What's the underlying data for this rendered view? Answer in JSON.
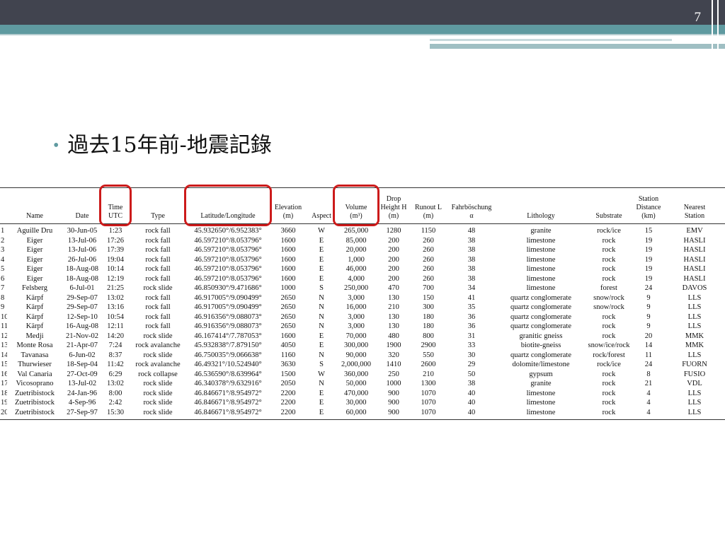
{
  "slide": {
    "page_number": "7",
    "bullet_title": "過去15年前-地震記錄"
  },
  "colors": {
    "top_band": "#41444f",
    "accent_teal": "#5f9aa0",
    "highlight_red": "#cc1b1b"
  },
  "table": {
    "headers": [
      {
        "key": "idx",
        "label": ""
      },
      {
        "key": "name",
        "label": "Name"
      },
      {
        "key": "date",
        "label": "Date"
      },
      {
        "key": "time",
        "label": "Time\nUTC"
      },
      {
        "key": "type",
        "label": "Type"
      },
      {
        "key": "latlon",
        "label": "Latitude/Longitude"
      },
      {
        "key": "elev",
        "label": "Elevation\n(m)"
      },
      {
        "key": "aspect",
        "label": "Aspect"
      },
      {
        "key": "volume",
        "label": "Volume\n(m³)"
      },
      {
        "key": "drop",
        "label": "Drop\nHeight H\n(m)"
      },
      {
        "key": "runout",
        "label": "Runout L\n(m)"
      },
      {
        "key": "fahr",
        "label": "Fahrböschung\nα"
      },
      {
        "key": "litho",
        "label": "Lithology"
      },
      {
        "key": "substrate",
        "label": "Substrate"
      },
      {
        "key": "dist",
        "label": "Station\nDistance\n(km)"
      },
      {
        "key": "station",
        "label": "Nearest\nStation"
      }
    ],
    "highlighted_columns": [
      "time",
      "latlon",
      "volume"
    ],
    "rows": [
      [
        "1",
        "Aguille Dru",
        "30-Jun-05",
        "1:23",
        "rock fall",
        "45.932650°/6.952383°",
        "3660",
        "W",
        "265,000",
        "1280",
        "1150",
        "48",
        "granite",
        "rock/ice",
        "15",
        "EMV"
      ],
      [
        "2",
        "Eiger",
        "13-Jul-06",
        "17:26",
        "rock fall",
        "46.597210°/8.053796°",
        "1600",
        "E",
        "85,000",
        "200",
        "260",
        "38",
        "limestone",
        "rock",
        "19",
        "HASLI"
      ],
      [
        "3",
        "Eiger",
        "13-Jul-06",
        "17:39",
        "rock fall",
        "46.597210°/8.053796°",
        "1600",
        "E",
        "20,000",
        "200",
        "260",
        "38",
        "limestone",
        "rock",
        "19",
        "HASLI"
      ],
      [
        "4",
        "Eiger",
        "26-Jul-06",
        "19:04",
        "rock fall",
        "46.597210°/8.053796°",
        "1600",
        "E",
        "1,000",
        "200",
        "260",
        "38",
        "limestone",
        "rock",
        "19",
        "HASLI"
      ],
      [
        "5",
        "Eiger",
        "18-Aug-08",
        "10:14",
        "rock fall",
        "46.597210°/8.053796°",
        "1600",
        "E",
        "46,000",
        "200",
        "260",
        "38",
        "limestone",
        "rock",
        "19",
        "HASLI"
      ],
      [
        "6",
        "Eiger",
        "18-Aug-08",
        "12:19",
        "rock fall",
        "46.597210°/8.053796°",
        "1600",
        "E",
        "4,000",
        "200",
        "260",
        "38",
        "limestone",
        "rock",
        "19",
        "HASLI"
      ],
      [
        "7",
        "Felsberg",
        "6-Jul-01",
        "21:25",
        "rock slide",
        "46.850930°/9.471686°",
        "1000",
        "S",
        "250,000",
        "470",
        "700",
        "34",
        "limestone",
        "forest",
        "24",
        "DAVOS"
      ],
      [
        "8",
        "Kärpf",
        "29-Sep-07",
        "13:02",
        "rock fall",
        "46.917005°/9.090499°",
        "2650",
        "N",
        "3,000",
        "130",
        "150",
        "41",
        "quartz conglomerate",
        "snow/rock",
        "9",
        "LLS"
      ],
      [
        "9",
        "Kärpf",
        "29-Sep-07",
        "13:16",
        "rock fall",
        "46.917005°/9.090499°",
        "2650",
        "N",
        "16,000",
        "210",
        "300",
        "35",
        "quartz conglomerate",
        "snow/rock",
        "9",
        "LLS"
      ],
      [
        "10",
        "Kärpf",
        "12-Sep-10",
        "10:54",
        "rock fall",
        "46.916356°/9.088073°",
        "2650",
        "N",
        "3,000",
        "130",
        "180",
        "36",
        "quartz conglomerate",
        "rock",
        "9",
        "LLS"
      ],
      [
        "11",
        "Kärpf",
        "16-Aug-08",
        "12:11",
        "rock fall",
        "46.916356°/9.088073°",
        "2650",
        "N",
        "3,000",
        "130",
        "180",
        "36",
        "quartz conglomerate",
        "rock",
        "9",
        "LLS"
      ],
      [
        "12",
        "Medji",
        "21-Nov-02",
        "14:20",
        "rock slide",
        "46.167414°/7.787053°",
        "1600",
        "E",
        "70,000",
        "480",
        "800",
        "31",
        "granitic gneiss",
        "rock",
        "20",
        "MMK"
      ],
      [
        "13",
        "Monte Rosa",
        "21-Apr-07",
        "7:24",
        "rock avalanche",
        "45.932838°/7.879150°",
        "4050",
        "E",
        "300,000",
        "1900",
        "2900",
        "33",
        "biotite-gneiss",
        "snow/ice/rock",
        "14",
        "MMK"
      ],
      [
        "14",
        "Tavanasa",
        "6-Jun-02",
        "8:37",
        "rock slide",
        "46.750035°/9.066638°",
        "1160",
        "N",
        "90,000",
        "320",
        "550",
        "30",
        "quartz conglomerate",
        "rock/forest",
        "11",
        "LLS"
      ],
      [
        "15",
        "Thurwieser",
        "18-Sep-04",
        "11:42",
        "rock avalanche",
        "46.49321°/10.524940°",
        "3630",
        "S",
        "2,000,000",
        "1410",
        "2600",
        "29",
        "dolomite/limestone",
        "rock/ice",
        "24",
        "FUORN"
      ],
      [
        "16",
        "Val Canaria",
        "27-Oct-09",
        "6:29",
        "rock collapse",
        "46.536590°/8.639964°",
        "1500",
        "W",
        "360,000",
        "250",
        "210",
        "50",
        "gypsum",
        "rock",
        "8",
        "FUSIO"
      ],
      [
        "17",
        "Vicosoprano",
        "13-Jul-02",
        "13:02",
        "rock slide",
        "46.340378°/9.632916°",
        "2050",
        "N",
        "50,000",
        "1000",
        "1300",
        "38",
        "granite",
        "rock",
        "21",
        "VDL"
      ],
      [
        "18",
        "Zuetribistock",
        "24-Jan-96",
        "8:00",
        "rock slide",
        "46.846671°/8.954972°",
        "2200",
        "E",
        "470,000",
        "900",
        "1070",
        "40",
        "limestone",
        "rock",
        "4",
        "LLS"
      ],
      [
        "19",
        "Zuetribistock",
        "4-Sep-96",
        "2:42",
        "rock slide",
        "46.846671°/8.954972°",
        "2200",
        "E",
        "30,000",
        "900",
        "1070",
        "40",
        "limestone",
        "rock",
        "4",
        "LLS"
      ],
      [
        "20",
        "Zuetribistock",
        "27-Sep-97",
        "15:30",
        "rock slide",
        "46.846671°/8.954972°",
        "2200",
        "E",
        "60,000",
        "900",
        "1070",
        "40",
        "limestone",
        "rock",
        "4",
        "LLS"
      ]
    ]
  }
}
